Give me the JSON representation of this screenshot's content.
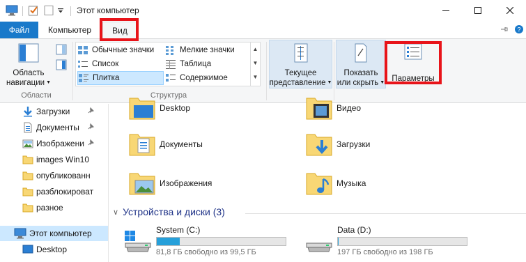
{
  "window": {
    "title": "Этот компьютер"
  },
  "ribbon": {
    "tabs": {
      "file": "Файл",
      "computer": "Компьютер",
      "view": "Вид"
    },
    "nav_pane_button": {
      "line1": "Область",
      "line2": "навигации"
    },
    "groups": {
      "areas": "Области",
      "structure": "Структура"
    },
    "layout_options": [
      {
        "label": "Обычные значки",
        "icon": "medium-icons-icon",
        "selected": false
      },
      {
        "label": "Мелкие значки",
        "icon": "small-icons-icon",
        "selected": false
      },
      {
        "label": "Список",
        "icon": "list-icon",
        "selected": false
      },
      {
        "label": "Таблица",
        "icon": "details-icon",
        "selected": false
      },
      {
        "label": "Плитка",
        "icon": "tiles-icon",
        "selected": true
      },
      {
        "label": "Содержимое",
        "icon": "content-icon",
        "selected": false
      }
    ],
    "current_view": {
      "line1": "Текущее",
      "line2": "представление"
    },
    "show_hide": {
      "line1": "Показать",
      "line2": "или скрыть"
    },
    "options": "Параметры"
  },
  "nav": {
    "items": [
      {
        "label": "Загрузки",
        "icon": "downloads-icon",
        "pinned": true
      },
      {
        "label": "Документы",
        "icon": "documents-icon",
        "pinned": true
      },
      {
        "label": "Изображени",
        "icon": "pictures-icon",
        "pinned": true
      },
      {
        "label": "images Win10",
        "icon": "folder-icon",
        "pinned": false
      },
      {
        "label": "опубликованн",
        "icon": "folder-icon",
        "pinned": false
      },
      {
        "label": "разблокироват",
        "icon": "folder-icon",
        "pinned": false
      },
      {
        "label": "разное",
        "icon": "folder-icon",
        "pinned": false
      },
      {
        "label": "Этот компьютер",
        "icon": "this-pc-icon",
        "pinned": false,
        "selected": true
      },
      {
        "label": "Desktop",
        "icon": "desktop-icon",
        "pinned": false
      }
    ]
  },
  "folders": [
    {
      "label": "Desktop",
      "icon": "desktop-folder-icon"
    },
    {
      "label": "Видео",
      "icon": "videos-folder-icon"
    },
    {
      "label": "Документы",
      "icon": "documents-folder-icon"
    },
    {
      "label": "Загрузки",
      "icon": "downloads-folder-icon"
    },
    {
      "label": "Изображения",
      "icon": "pictures-folder-icon"
    },
    {
      "label": "Музыка",
      "icon": "music-folder-icon"
    }
  ],
  "devices": {
    "header": "Устройства и диски (3)",
    "drives": [
      {
        "name": "System (C:)",
        "free_text": "81,8 ГБ свободно из 99,5 ГБ",
        "used_fraction": 0.178,
        "icon": "system-drive-icon"
      },
      {
        "name": "Data (D:)",
        "free_text": "197 ГБ свободно из 198 ГБ",
        "used_fraction": 0.005,
        "icon": "hard-drive-icon"
      }
    ]
  },
  "colors": {
    "file_tab": "#1979ca",
    "highlight": "#e8141a",
    "drive_fill": "#26a0da",
    "section_header": "#1e3287"
  }
}
